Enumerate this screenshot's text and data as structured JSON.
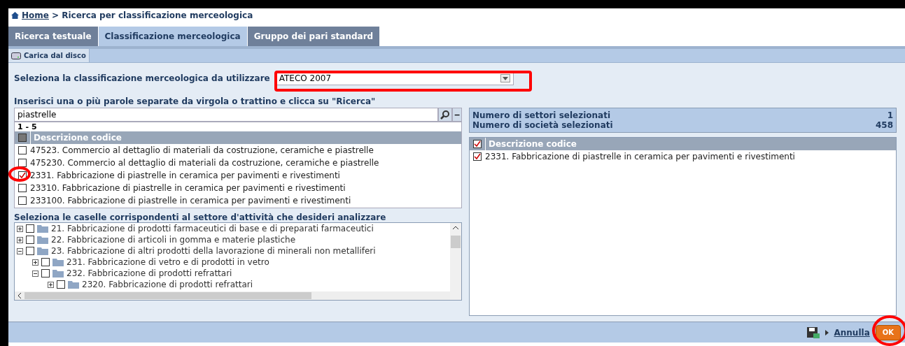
{
  "breadcrumb": {
    "home": "Home",
    "trail": "> Ricerca per classificazione merceologica"
  },
  "tabs": [
    {
      "label": "Ricerca testuale",
      "selected": false
    },
    {
      "label": "Classificazione merceologica",
      "selected": true
    },
    {
      "label": "Gruppo dei pari standard",
      "selected": false
    }
  ],
  "toolbar": {
    "button": "Carica dal disco"
  },
  "classification": {
    "label": "Seleziona la classificazione merceologica da utilizzare",
    "value": "ATECO 2007"
  },
  "search": {
    "label": "Inserisci una o più parole separate da virgola o trattino e clicca su \"Ricerca\"",
    "value": "piastrelle",
    "collapse": "−"
  },
  "results": {
    "range": "1 - 5",
    "header": "Descrizione codice",
    "header_checked": false,
    "rows": [
      {
        "text": "47523. Commercio al dettaglio di materiali da costruzione, ceramiche e piastrelle",
        "checked": false
      },
      {
        "text": "475230. Commercio al dettaglio di materiali da costruzione, ceramiche e piastrelle",
        "checked": false
      },
      {
        "text": "2331. Fabbricazione di piastrelle in ceramica per pavimenti e rivestimenti",
        "checked": true
      },
      {
        "text": "23310. Fabbricazione di piastrelle in ceramica per pavimenti e rivestimenti",
        "checked": false
      },
      {
        "text": "233100. Fabbricazione di piastrelle in ceramica per pavimenti e rivestimenti",
        "checked": false
      }
    ]
  },
  "tree": {
    "label": "Seleziona le caselle corrispondenti al settore d'attività che desideri analizzare",
    "items": [
      {
        "text": "21. Fabbricazione di prodotti farmaceutici di base e di preparati farmaceutici",
        "expanded": false,
        "checked": false
      },
      {
        "text": "22. Fabbricazione di articoli in gomma e materie plastiche",
        "expanded": false,
        "checked": false
      },
      {
        "text": "23. Fabbricazione di altri prodotti della lavorazione di minerali non metalliferi",
        "expanded": true,
        "checked": false,
        "children": [
          {
            "text": "231. Fabbricazione di vetro e di prodotti in vetro",
            "expanded": false,
            "checked": false
          },
          {
            "text": "232. Fabbricazione di prodotti refrattari",
            "expanded": true,
            "checked": false,
            "children": [
              {
                "text": "2320. Fabbricazione di prodotti refrattari",
                "expanded": false,
                "checked": false
              }
            ]
          }
        ]
      }
    ]
  },
  "stats": [
    {
      "label": "Numero di settori selezionati",
      "value": "1"
    },
    {
      "label": "Numero di società selezionati",
      "value": "458"
    }
  ],
  "selected": {
    "header": "Descrizione codice",
    "header_checked": true,
    "rows": [
      {
        "text": "2331. Fabbricazione di piastrelle in ceramica per pavimenti e rivestimenti",
        "checked": true
      }
    ]
  },
  "footer": {
    "cancel": "Annulla",
    "ok": "OK"
  }
}
